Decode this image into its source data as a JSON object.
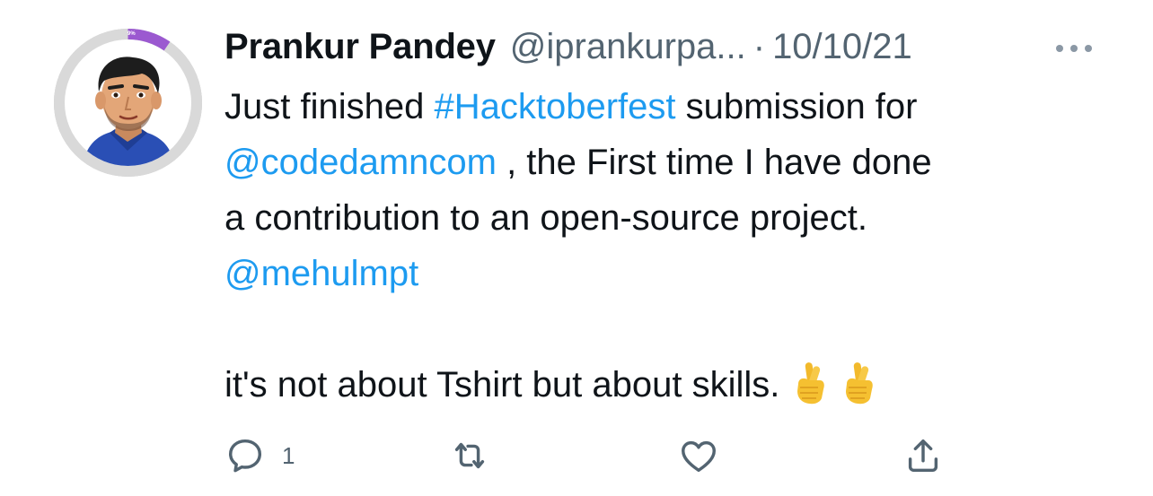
{
  "tweet": {
    "author_name": "Prankur Pandey",
    "author_handle": "@iprankurpa...",
    "separator": "·",
    "date": "10/10/21",
    "avatar_badge": "9%",
    "text_lines": [
      {
        "parts": [
          {
            "text": "Just finished  ",
            "type": "text"
          },
          {
            "text": "#Hacktoberfest",
            "type": "link"
          },
          {
            "text": " submission for",
            "type": "text"
          }
        ]
      },
      {
        "parts": [
          {
            "text": "@codedamncom",
            "type": "link"
          },
          {
            "text": " , the First time I have done",
            "type": "text"
          }
        ]
      },
      {
        "parts": [
          {
            "text": "a contribution to an open-source project.",
            "type": "text"
          }
        ]
      },
      {
        "parts": [
          {
            "text": "@mehulmpt",
            "type": "link"
          }
        ]
      },
      {
        "parts": []
      },
      {
        "parts": [
          {
            "text": "it's not about Tshirt but about skills.",
            "type": "text"
          }
        ]
      }
    ],
    "emojis": [
      "crossed-fingers-emoji",
      "crossed-fingers-emoji"
    ],
    "actions": {
      "reply_count": "1",
      "retweet_count": "",
      "like_count": "",
      "share_count": ""
    },
    "colors": {
      "link": "#1d9bf0",
      "secondary_text": "#536471",
      "primary_text": "#0f1419",
      "avatar_ring": "#d9d9d9",
      "avatar_progress": "#9b59d0"
    }
  }
}
